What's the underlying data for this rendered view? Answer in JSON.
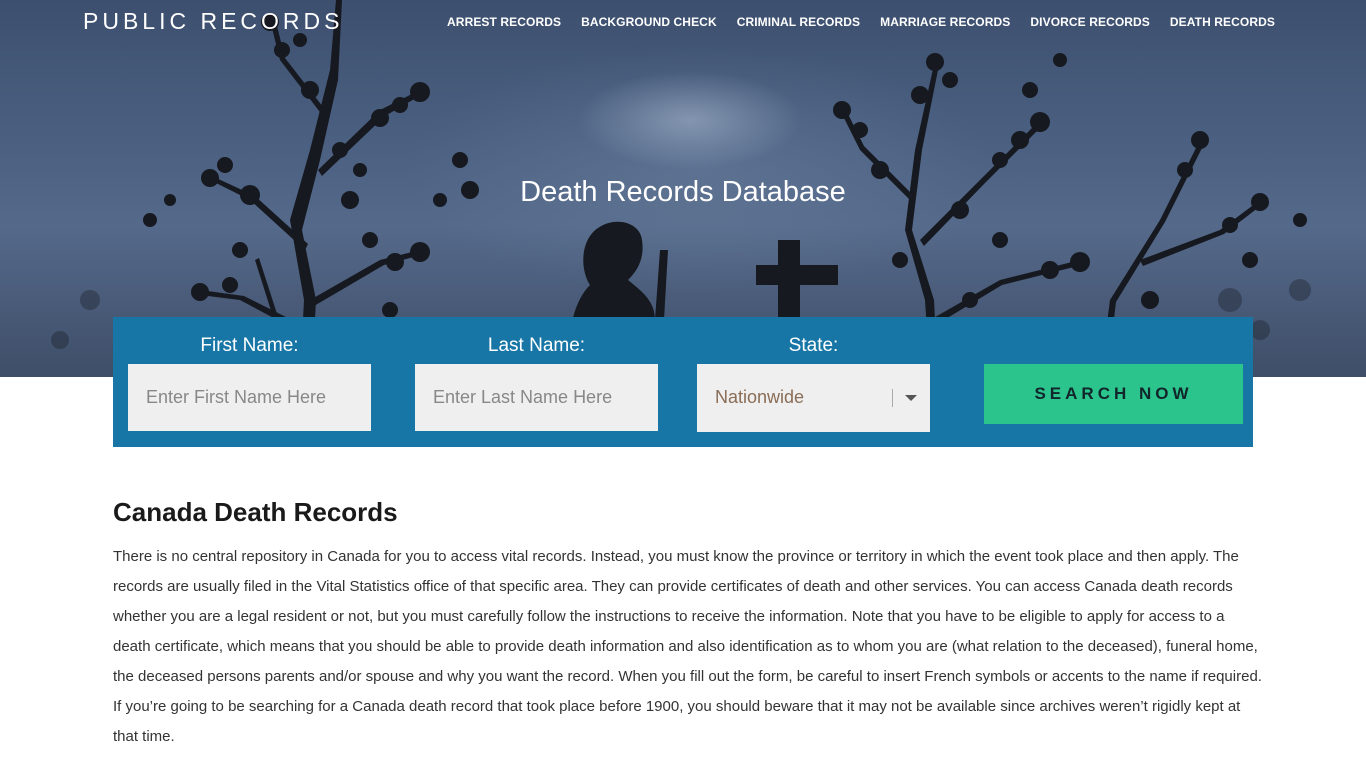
{
  "header": {
    "logo": "PUBLIC RECORDS",
    "nav": [
      {
        "label": "ARREST RECORDS"
      },
      {
        "label": "BACKGROUND CHECK"
      },
      {
        "label": "CRIMINAL RECORDS"
      },
      {
        "label": "MARRIAGE RECORDS"
      },
      {
        "label": "DIVORCE RECORDS"
      },
      {
        "label": "DEATH RECORDS"
      }
    ]
  },
  "hero": {
    "title": "Death Records Database"
  },
  "search": {
    "first_name_label": "First Name:",
    "first_name_placeholder": "Enter First Name Here",
    "last_name_label": "Last Name:",
    "last_name_placeholder": "Enter Last Name Here",
    "state_label": "State:",
    "state_value": "Nationwide",
    "button_label": "SEARCH NOW"
  },
  "content": {
    "title": "Canada Death Records",
    "body": "There is no central repository in Canada for you to access vital records. Instead, you must know the province or territory in which the event took place and then apply. The records are usually filed in the Vital Statistics office of that specific area. They can provide certificates of death and other services. You can access Canada death records whether you are a legal resident or not, but you must carefully follow the instructions to receive the information. Note that you have to be eligible to apply for access to a death certificate, which means that you should be able to provide death information and also identification as to whom you are (what relation to the deceased), funeral home, the deceased persons parents and/or spouse and why you want the record. When you fill out the form, be careful to insert French symbols or accents to the name if required. If you’re going to be searching for a Canada death record that took place before 1900, you should beware that it may not be available since archives weren’t rigidly kept at that time."
  },
  "colors": {
    "panel": "#1776a6",
    "button": "#2bc48d",
    "hero_sky": "#4a5f80"
  }
}
